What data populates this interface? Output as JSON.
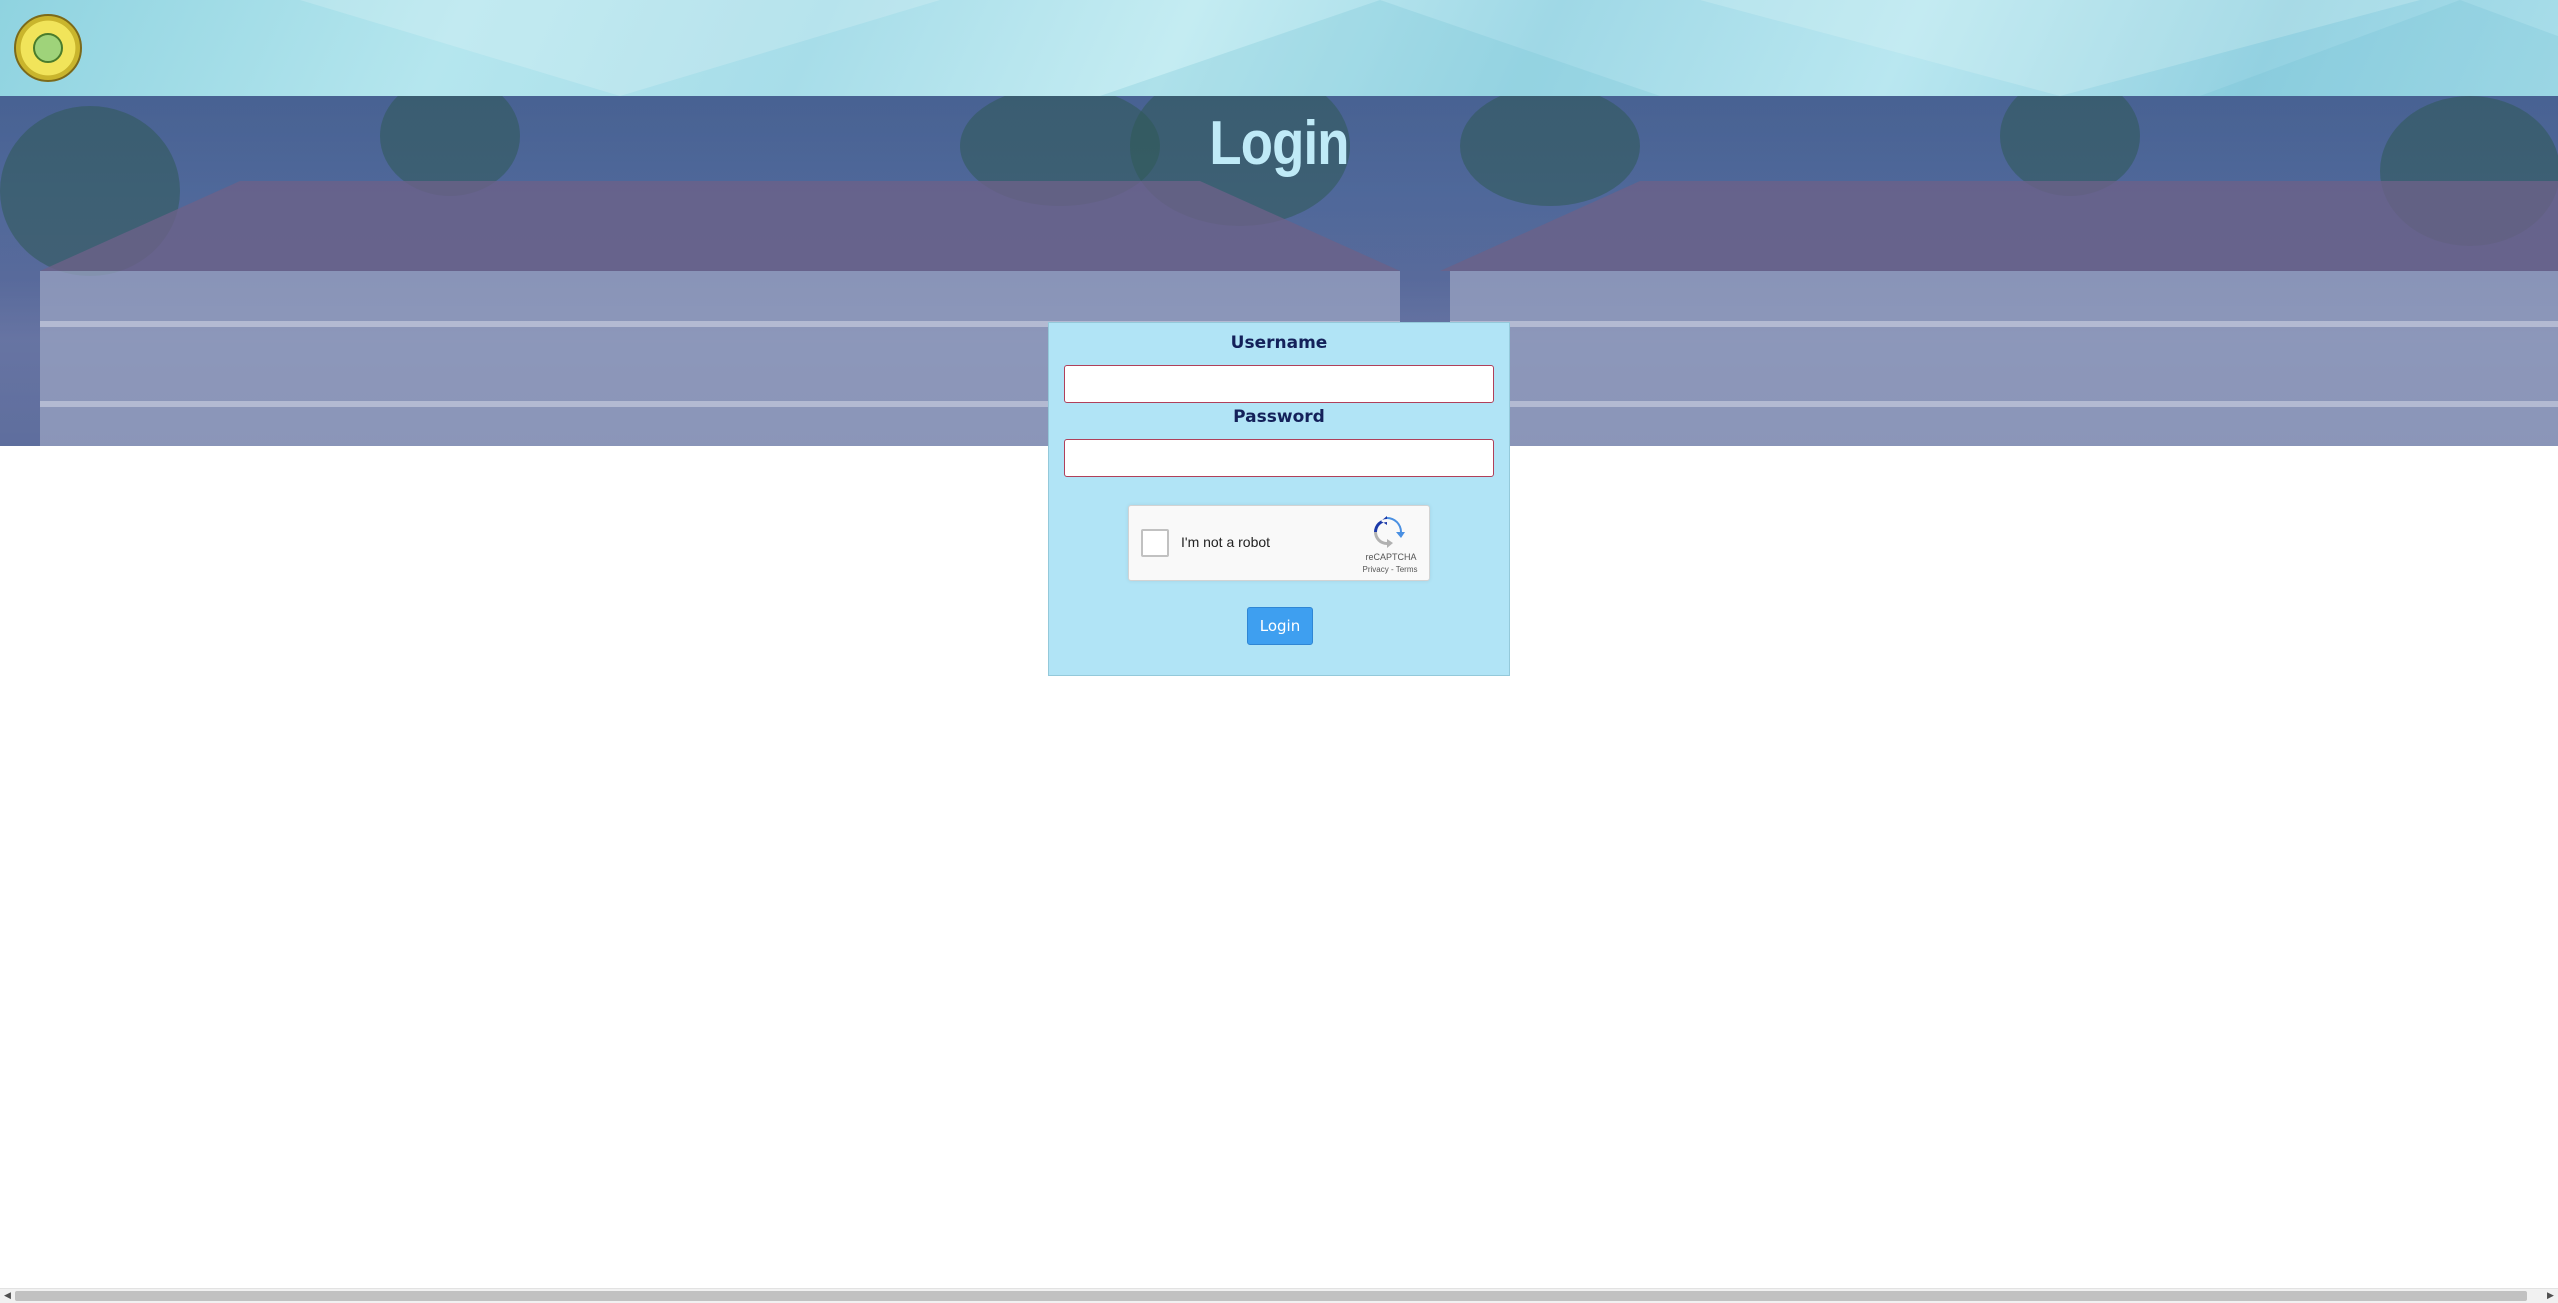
{
  "hero": {
    "title": "Login"
  },
  "form": {
    "username_label": "Username",
    "username_value": "",
    "password_label": "Password",
    "password_value": "",
    "submit_label": "Login"
  },
  "captcha": {
    "label": "I'm not a robot",
    "brand": "reCAPTCHA",
    "privacy": "Privacy",
    "separator": " - ",
    "terms": "Terms"
  },
  "colors": {
    "card_bg": "#b1e4f6",
    "label_text": "#14215a",
    "button_bg": "#3e9ff0",
    "hero_title": "#bfeaf7",
    "input_border": "#b0405a"
  },
  "icons": {
    "logo": "municipal-seal-icon",
    "captcha": "recaptcha-icon",
    "scroll_left": "scroll-left-arrow-icon",
    "scroll_right": "scroll-right-arrow-icon"
  }
}
